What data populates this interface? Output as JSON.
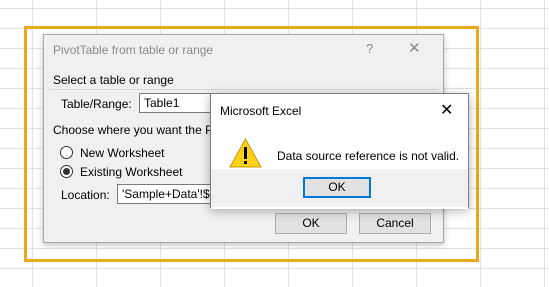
{
  "pivot_dialog": {
    "title": "PivotTable from table or range",
    "help_icon": "?",
    "close_icon": "✕",
    "select_section": "Select a table or range",
    "table_range_label": "Table/Range:",
    "table_range_value": "Table1",
    "choose_section": "Choose where you want the Piv",
    "new_worksheet_label": "New Worksheet",
    "existing_worksheet_label": "Existing Worksheet",
    "selected_option": "Existing Worksheet",
    "location_label": "Location:",
    "location_value": "'Sample+Data'!$L",
    "ok_label": "OK",
    "cancel_label": "Cancel"
  },
  "message_box": {
    "title": "Microsoft Excel",
    "close_icon": "✕",
    "icon": "warning-icon",
    "message": "Data source reference is not valid.",
    "ok_label": "OK"
  },
  "colors": {
    "highlight": "#e8a91c",
    "focus": "#0078d7",
    "warning": "#fcd116"
  }
}
